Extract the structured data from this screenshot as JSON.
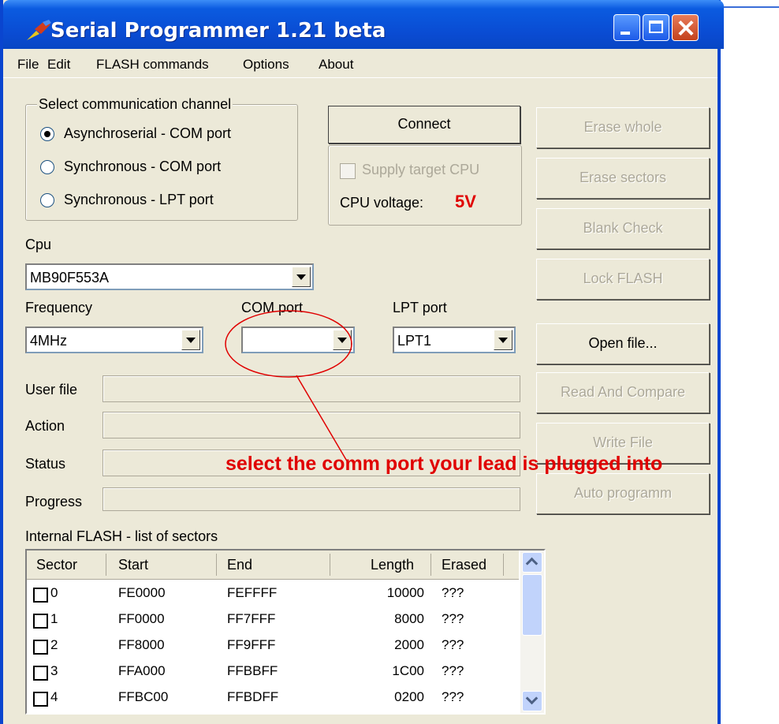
{
  "window": {
    "title": "Serial Programmer 1.21 beta"
  },
  "menu": [
    "File",
    "Edit",
    "FLASH commands",
    "Options",
    "About"
  ],
  "channel": {
    "title": "Select communication channel",
    "options": [
      "Asynchroserial - COM port",
      "Synchronous - COM port",
      "Synchronous - LPT port"
    ],
    "selected": 0
  },
  "connect_label": "Connect",
  "supply": {
    "label": "Supply target CPU",
    "checked": false
  },
  "cpu_voltage": {
    "label": "CPU voltage:",
    "value": "5V"
  },
  "cpu": {
    "label": "Cpu",
    "value": "MB90F553A"
  },
  "frequency": {
    "label": "Frequency",
    "value": "4MHz"
  },
  "com_port": {
    "label": "COM port",
    "value": ""
  },
  "lpt_port": {
    "label": "LPT port",
    "value": "LPT1"
  },
  "fields": {
    "user_file": "User file",
    "action": "Action",
    "status": "Status",
    "progress": "Progress"
  },
  "buttons": {
    "erase_whole": "Erase whole",
    "erase_sectors": "Erase sectors",
    "blank_check": "Blank Check",
    "lock_flash": "Lock FLASH",
    "open_file": "Open file...",
    "read_compare": "Read And Compare",
    "write_file": "Write File",
    "auto_program": "Auto programm"
  },
  "sectors": {
    "title": "Internal FLASH - list of sectors",
    "columns": [
      "Sector",
      "Start",
      "End",
      "Length",
      "Erased"
    ],
    "rows": [
      [
        "0",
        "FE0000",
        "FEFFFF",
        "10000",
        "???"
      ],
      [
        "1",
        "FF0000",
        "FF7FFF",
        "8000",
        "???"
      ],
      [
        "2",
        "FF8000",
        "FF9FFF",
        "2000",
        "???"
      ],
      [
        "3",
        "FFA000",
        "FFBBFF",
        "1C00",
        "???"
      ],
      [
        "4",
        "FFBC00",
        "FFBDFF",
        "0200",
        "???"
      ]
    ]
  },
  "annotation": "select the comm port your lead is plugged into",
  "colors": {
    "titlebar": "#0a4bd2",
    "annotation": "#e00000",
    "voltage": "#e00000",
    "window_bg": "#ece9d8"
  }
}
